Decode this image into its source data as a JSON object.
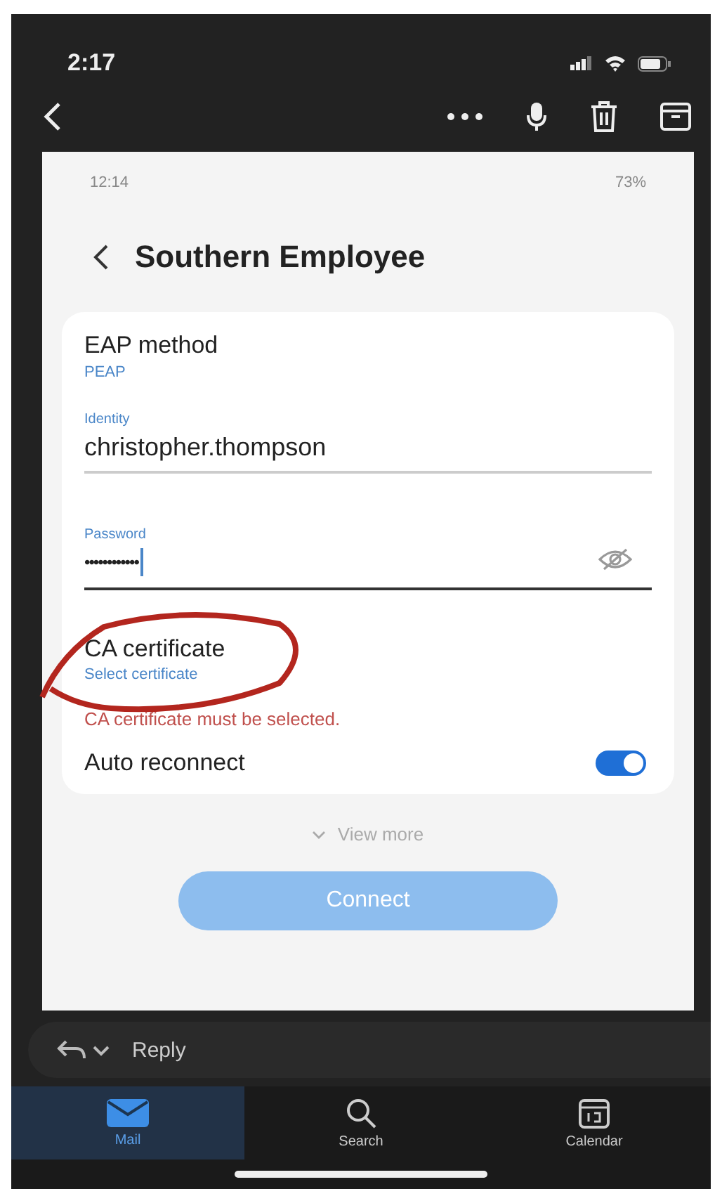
{
  "status_bar": {
    "time": "2:17"
  },
  "screenshot": {
    "status_bar": {
      "time": "12:14",
      "battery": "73%"
    },
    "title": "Southern Employee",
    "eap": {
      "label": "EAP method",
      "value": "PEAP"
    },
    "identity": {
      "label": "Identity",
      "value": "christopher.thompson"
    },
    "password": {
      "label": "Password",
      "value": "••••••••••••"
    },
    "ca_certificate": {
      "label": "CA certificate",
      "value": "Select certificate",
      "error": "CA certificate must be selected.",
      "circled": true
    },
    "auto_reconnect": {
      "label": "Auto reconnect",
      "on": true
    },
    "view_more": "View more",
    "connect": {
      "label": "Connect",
      "disabled": true
    }
  },
  "reply": {
    "label": "Reply"
  },
  "tabs": [
    {
      "label": "Mail",
      "selected": true
    },
    {
      "label": "Search",
      "selected": false
    },
    {
      "label": "Calendar",
      "selected": false
    }
  ]
}
